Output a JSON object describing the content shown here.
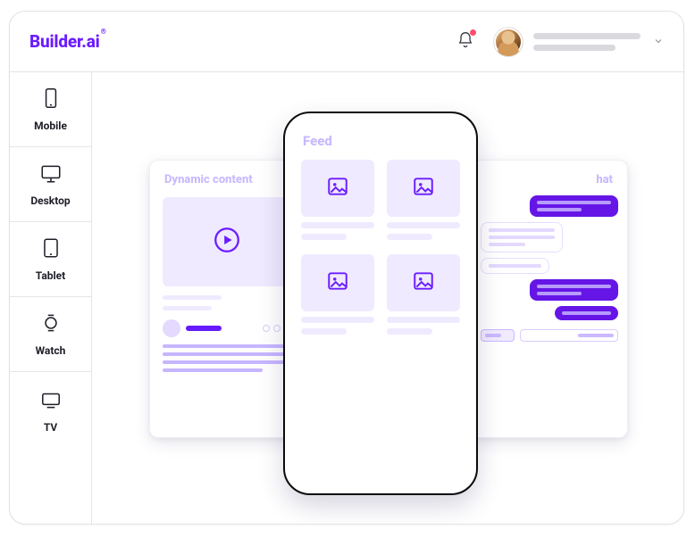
{
  "header": {
    "logo_text": "Builder.ai",
    "logo_mark": "®",
    "bell_icon": "bell-icon",
    "notification_indicator": true,
    "user_dropdown_icon": "chevron-down-icon"
  },
  "sidebar": {
    "items": [
      {
        "id": "mobile",
        "label": "Mobile"
      },
      {
        "id": "desktop",
        "label": "Desktop"
      },
      {
        "id": "tablet",
        "label": "Tablet"
      },
      {
        "id": "watch",
        "label": "Watch"
      },
      {
        "id": "tv",
        "label": "TV"
      }
    ]
  },
  "panels": {
    "left": {
      "title": "Dynamic content"
    },
    "center": {
      "title": "Feed"
    },
    "right": {
      "title_fragment": "hat"
    }
  },
  "colors": {
    "brand": "#6b1cff",
    "brand_dark": "#6516e6",
    "brand_wash": "#efeaff",
    "brand_muted_text": "#c9b9ff",
    "notification": "#ff4d6d"
  }
}
